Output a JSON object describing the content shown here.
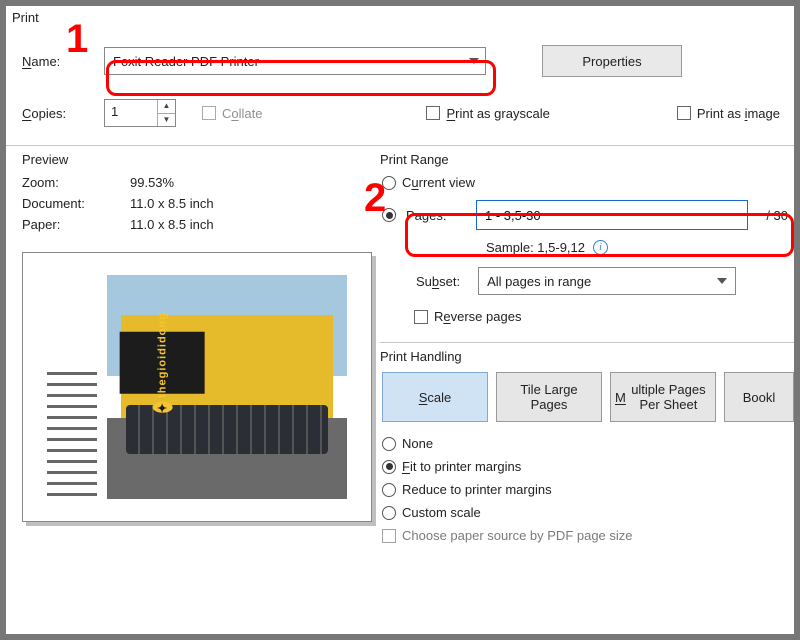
{
  "window": {
    "title": "Print"
  },
  "printer": {
    "name_label": "Name:",
    "selected": "Foxit Reader PDF Printer",
    "properties_label": "Properties"
  },
  "copies": {
    "label": "Copies:",
    "value": "1",
    "collate_label": "Collate"
  },
  "options": {
    "grayscale": "Print as grayscale",
    "as_image": "Print as image"
  },
  "preview": {
    "title": "Preview",
    "zoom_label": "Zoom:",
    "zoom_value": "99.53%",
    "document_label": "Document:",
    "document_value": "11.0 x 8.5 inch",
    "paper_label": "Paper:",
    "paper_value": "11.0 x 8.5 inch",
    "sign_text": "thegioididong"
  },
  "print_range": {
    "title": "Print Range",
    "current_view": "Current view",
    "pages_label": "Pages:",
    "pages_value": "1 - 3,5-30",
    "total_text": "/ 30",
    "sample_text": "Sample: 1,5-9,12",
    "subset_label": "Subset:",
    "subset_value": "All pages in range",
    "reverse_label": "Reverse pages"
  },
  "handling": {
    "title": "Print Handling",
    "tabs": {
      "scale": "Scale",
      "tile": "Tile Large Pages",
      "multi": "Multiple Pages Per Sheet",
      "booklet": "Bookl"
    },
    "none": "None",
    "fit": "Fit to printer margins",
    "reduce": "Reduce to printer margins",
    "custom": "Custom scale",
    "paper_source": "Choose paper source by PDF page size"
  },
  "callouts": {
    "one": "1",
    "two": "2"
  }
}
